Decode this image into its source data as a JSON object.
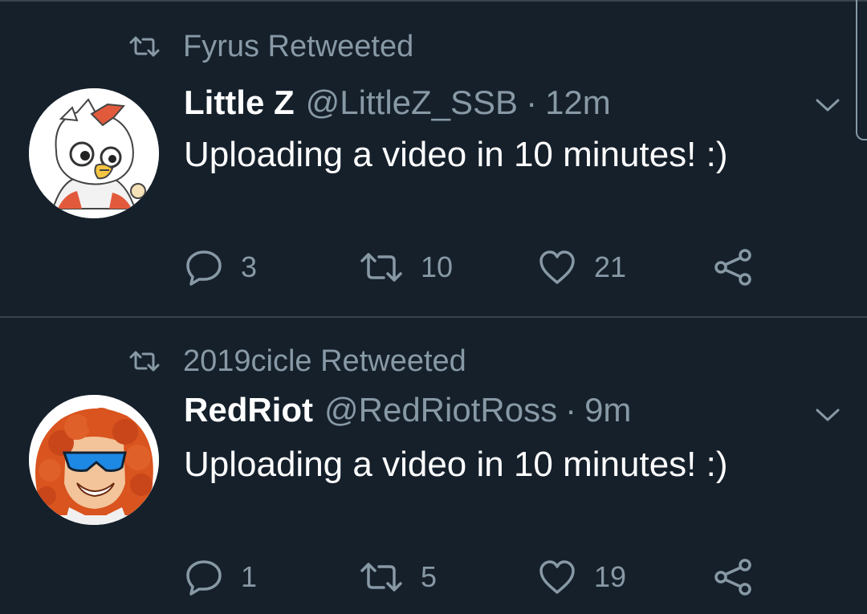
{
  "colors": {
    "background": "#15202b",
    "divider": "#38444d",
    "secondary_text": "#8899a6",
    "primary_text": "#ffffff"
  },
  "tweets": [
    {
      "retweeted_by": "Fyrus Retweeted",
      "display_name": "Little Z",
      "handle": "@LittleZ_SSB",
      "separator": "·",
      "time": "12m",
      "text": "Uploading a video in 10 minutes! :)",
      "replies": "3",
      "retweets": "10",
      "likes": "21",
      "avatar_icon": "owl-bird-avatar"
    },
    {
      "retweeted_by": "2019cicle Retweeted",
      "display_name": "RedRiot",
      "handle": "@RedRiotRoss",
      "separator": "·",
      "time": "9m",
      "text": "Uploading a video in 10 minutes! :)",
      "replies": "1",
      "retweets": "5",
      "likes": "19",
      "avatar_icon": "red-hair-sunglasses-avatar"
    }
  ]
}
